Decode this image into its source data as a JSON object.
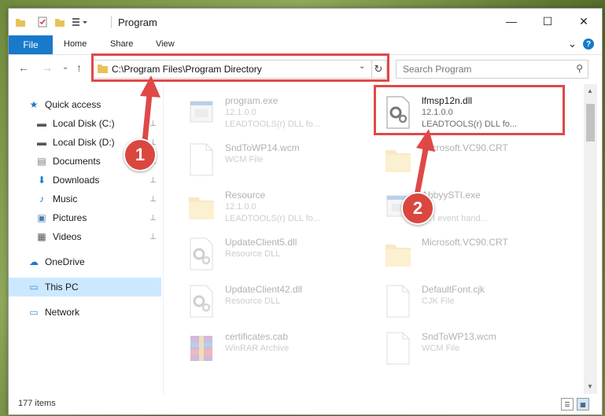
{
  "window": {
    "title": "Program",
    "controls": {
      "minimize": "—",
      "maximize": "☐",
      "close": "✕"
    }
  },
  "ribbon": {
    "tabs": [
      "File",
      "Home",
      "Share",
      "View"
    ],
    "expand_icon": "⌄",
    "help_icon": "?"
  },
  "navigation": {
    "back": "←",
    "forward": "→",
    "recent": "⌄",
    "up": "↑",
    "address": "C:\\Program Files\\Program Directory",
    "refresh": "↻",
    "search_placeholder": "Search Program"
  },
  "sidebar": {
    "items": [
      {
        "label": "Quick access",
        "icon": "star-icon",
        "glyph": "★",
        "pinned": false
      },
      {
        "label": "Local Disk (C:)",
        "icon": "drive-icon",
        "glyph": "▬",
        "pinned": true
      },
      {
        "label": "Local Disk (D:)",
        "icon": "drive-icon",
        "glyph": "▬",
        "pinned": true
      },
      {
        "label": "Documents",
        "icon": "documents-icon",
        "glyph": "▤",
        "pinned": true
      },
      {
        "label": "Downloads",
        "icon": "downloads-icon",
        "glyph": "⬇",
        "pinned": true
      },
      {
        "label": "Music",
        "icon": "music-icon",
        "glyph": "♪",
        "pinned": true
      },
      {
        "label": "Pictures",
        "icon": "pictures-icon",
        "glyph": "▣",
        "pinned": true
      },
      {
        "label": "Videos",
        "icon": "videos-icon",
        "glyph": "▦",
        "pinned": true
      },
      {
        "label": "OneDrive",
        "icon": "cloud-icon",
        "glyph": "☁",
        "pinned": false
      },
      {
        "label": "This PC",
        "icon": "computer-icon",
        "glyph": "▭",
        "pinned": false
      },
      {
        "label": "Network",
        "icon": "network-icon",
        "glyph": "▭",
        "pinned": false
      }
    ],
    "pin_glyph": "📌"
  },
  "files": [
    {
      "name": "program.exe",
      "line1": "12.1.0.0",
      "line2": "LEADTOOLS(r) DLL fo...",
      "icon": "exe-icon"
    },
    {
      "name": "lfmsp12n.dll",
      "line1": "12.1.0.0",
      "line2": "LEADTOOLS(r) DLL fo...",
      "icon": "dll-gear-icon"
    },
    {
      "name": "SndToWP14.wcm",
      "line1": "WCM File",
      "line2": "",
      "icon": "file-icon"
    },
    {
      "name": "Microsoft.VC90.CRT",
      "line1": "",
      "line2": "",
      "icon": "folder-icon"
    },
    {
      "name": "Resource",
      "line1": "12.1.0.0",
      "line2": "LEADTOOLS(r) DLL fo...",
      "icon": "folder-icon"
    },
    {
      "name": "AbbyySTI.exe",
      "line1": "",
      "line2": "STI event hand...",
      "icon": "exe-icon"
    },
    {
      "name": "UpdateClient5.dll",
      "line1": "Resource DLL",
      "line2": "",
      "icon": "dll-gear-icon"
    },
    {
      "name": "Microsoft.VC90.CRT",
      "line1": "",
      "line2": "",
      "icon": "folder-icon"
    },
    {
      "name": "UpdateClient42.dll",
      "line1": "Resource DLL",
      "line2": "",
      "icon": "dll-gear-icon"
    },
    {
      "name": "DefaultFont.cjk",
      "line1": "CJK File",
      "line2": "",
      "icon": "file-icon"
    },
    {
      "name": "certificates.cab",
      "line1": "WinRAR Archive",
      "line2": "",
      "icon": "archive-icon"
    },
    {
      "name": "SndToWP13.wcm",
      "line1": "WCM File",
      "line2": "",
      "icon": "file-icon"
    }
  ],
  "status": {
    "items": "177 items"
  },
  "annotations": {
    "step1": "1",
    "step2": "2"
  },
  "colors": {
    "accent": "#1979ca",
    "highlight": "#e04848",
    "selected": "#cce8ff"
  }
}
